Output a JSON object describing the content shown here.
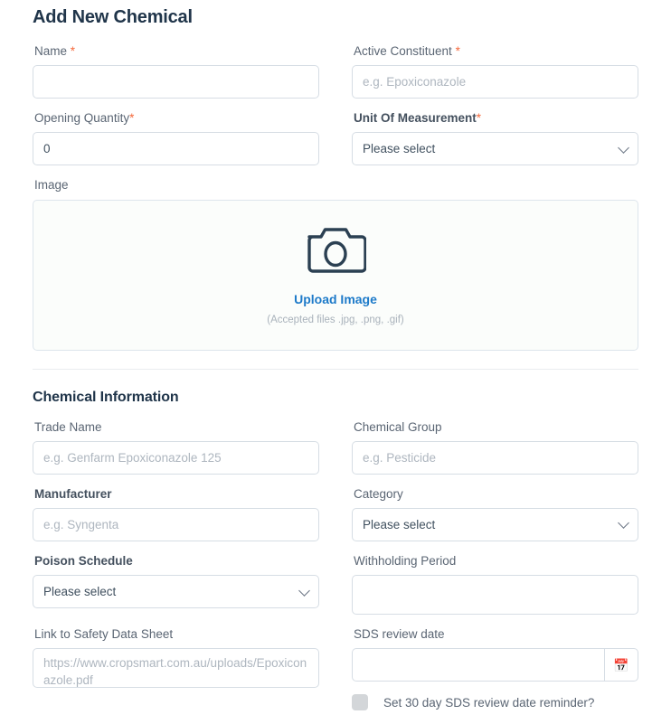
{
  "page": {
    "title": "Add New Chemical"
  },
  "primary_section": {
    "fields": {
      "name": {
        "label": "Name",
        "required_mark": "*",
        "value": "",
        "placeholder": ""
      },
      "active_constituent": {
        "label": "Active Constituent",
        "required_mark": "*",
        "value": "",
        "placeholder": "e.g. Epoxiconazole"
      },
      "opening_quantity": {
        "label": "Opening Quantity",
        "required_mark": "*",
        "value": "0",
        "placeholder": ""
      },
      "unit_of_measurement": {
        "label": "Unit Of Measurement",
        "required_mark": "*",
        "selected": "Please select",
        "options": [
          "Please select"
        ]
      },
      "image": {
        "label": "Image",
        "upload_link": "Upload Image",
        "hint": "(Accepted files .jpg, .png, .gif)",
        "icon": "camera-icon"
      }
    }
  },
  "chemical_information": {
    "heading": "Chemical Information",
    "fields": {
      "trade_name": {
        "label": "Trade Name",
        "value": "",
        "placeholder": "e.g. Genfarm Epoxiconazole 125"
      },
      "chemical_group": {
        "label": "Chemical Group",
        "value": "",
        "placeholder": "e.g. Pesticide"
      },
      "manufacturer": {
        "label": "Manufacturer",
        "value": "",
        "placeholder": "e.g. Syngenta"
      },
      "category": {
        "label": "Category",
        "selected": "Please select",
        "options": [
          "Please select"
        ]
      },
      "poison_schedule": {
        "label": "Poison Schedule",
        "selected": "Please select",
        "options": [
          "Please select"
        ]
      },
      "withholding_period": {
        "label": "Withholding Period",
        "value": "",
        "placeholder": ""
      },
      "link_to_sds": {
        "label": "Link to Safety Data Sheet",
        "value": "",
        "placeholder": "https://www.cropsmart.com.au/uploads/Epoxiconazole.pdf"
      },
      "sds_review_date": {
        "label": "SDS review date",
        "value": "",
        "placeholder": "",
        "calendar_icon": "calendar-icon"
      },
      "sds_reminder": {
        "label": "Set 30 day SDS review date reminder?",
        "checked": false
      }
    }
  },
  "colors": {
    "title": "#20354a",
    "label": "#5a6573",
    "required_asterisk": "#f5693c",
    "link": "#1d7ac9",
    "border": "#d6dde4",
    "upload_bg": "#fbfdfb",
    "checkbox": "#d3d6d9"
  }
}
